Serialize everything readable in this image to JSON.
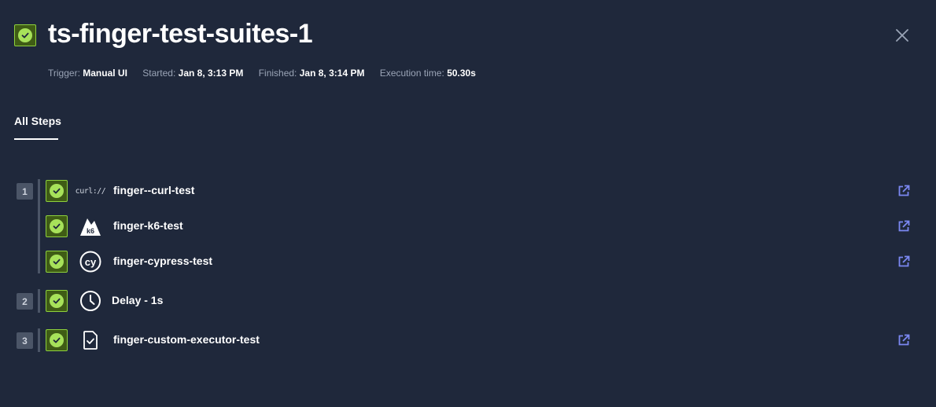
{
  "header": {
    "title": "ts-finger-test-suites-1",
    "close_icon": "close-icon",
    "status_icon": "check-circle-icon"
  },
  "meta": {
    "trigger_label": "Trigger:",
    "trigger_value": "Manual UI",
    "started_label": "Started:",
    "started_value": "Jan 8, 3:13 PM",
    "finished_label": "Finished:",
    "finished_value": "Jan 8, 3:14 PM",
    "execution_label": "Execution time:",
    "execution_value": "50.30s"
  },
  "tabs": [
    {
      "label": "All Steps",
      "active": true
    }
  ],
  "steps": [
    {
      "number": "1"
    },
    {
      "number": "2"
    },
    {
      "number": "3"
    }
  ],
  "items": [
    {
      "name": "finger--curl-test",
      "icon": "curl-logo",
      "icon_text": "curl://"
    },
    {
      "name": "finger-k6-test",
      "icon": "k6-logo",
      "icon_text": "k6"
    },
    {
      "name": "finger-cypress-test",
      "icon": "cypress-logo",
      "icon_text": "cy"
    },
    {
      "name": "Delay - 1s",
      "icon": "clock-icon"
    },
    {
      "name": "finger-custom-executor-test",
      "icon": "file-check-icon"
    }
  ],
  "colors": {
    "background": "#1f283b",
    "success": "#a7e25a",
    "success_border": "#8ed13c",
    "link": "#7b88f2",
    "muted": "#9aa4b6"
  }
}
